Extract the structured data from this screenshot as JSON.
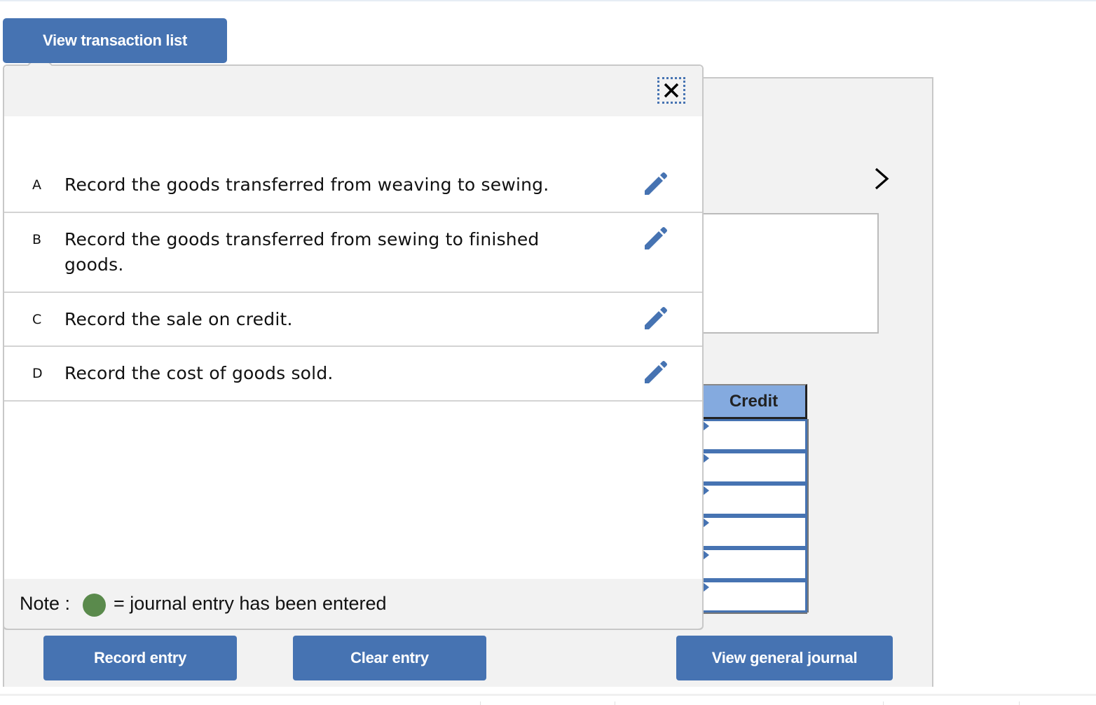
{
  "header": {
    "view_transaction_list_label": "View transaction list"
  },
  "popup": {
    "close_icon": "close-x-icon",
    "transactions": [
      {
        "letter": "A",
        "description": "Record the goods transferred from weaving to sewing.",
        "icon": "pencil-edit-icon"
      },
      {
        "letter": "B",
        "description": "Record the goods transferred from sewing to finished goods.",
        "icon": "pencil-edit-icon"
      },
      {
        "letter": "C",
        "description": "Record the sale on credit.",
        "icon": "pencil-edit-icon"
      },
      {
        "letter": "D",
        "description": "Record the cost of goods sold.",
        "icon": "pencil-edit-icon"
      }
    ],
    "note": {
      "label": "Note :",
      "text": "= journal entry has been entered",
      "dot_color": "#5a8a4c"
    }
  },
  "journal": {
    "next_icon": "chevron-right-icon",
    "credit_header": "Credit",
    "credit_rows": [
      "",
      "",
      "",
      "",
      "",
      ""
    ]
  },
  "actions": {
    "record_entry_label": "Record entry",
    "clear_entry_label": "Clear entry",
    "view_general_journal_label": "View general journal"
  },
  "colors": {
    "accent": "#4673b2",
    "header_blue": "#84aadf",
    "panel_gray": "#f2f2f2"
  }
}
